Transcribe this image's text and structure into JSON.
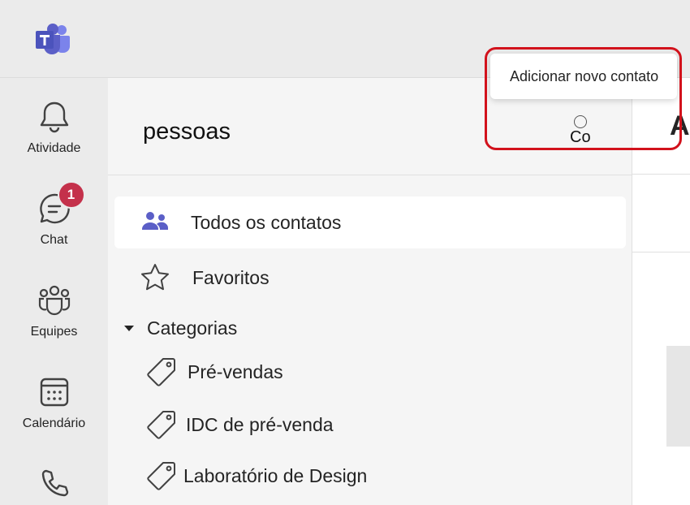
{
  "app": {
    "logo_icon": "teams-logo-icon"
  },
  "rail": {
    "items": [
      {
        "label": "Atividade",
        "icon": "bell-icon"
      },
      {
        "label": "Chat",
        "icon": "chat-icon",
        "badge": "1"
      },
      {
        "label": "Equipes",
        "icon": "teams-icon"
      },
      {
        "label": "Calendário",
        "icon": "calendar-icon"
      },
      {
        "label": "",
        "icon": "phone-icon"
      }
    ]
  },
  "panel": {
    "title": "pessoas",
    "header_action_text": "Co",
    "nav": [
      {
        "label": "Todos os contatos",
        "icon": "people-icon",
        "selected": true
      },
      {
        "label": "Favoritos",
        "icon": "star-icon",
        "selected": false
      }
    ],
    "categories_label": "Categorias",
    "categories": [
      {
        "label": "Pré-vendas",
        "icon": "tag-icon"
      },
      {
        "label": "IDC de pré-venda",
        "icon": "tag-icon"
      },
      {
        "label": "Laboratório de Design",
        "icon": "tag-icon"
      }
    ]
  },
  "right_pane": {
    "heading": "A"
  },
  "popup": {
    "label": "Adicionar novo contato"
  },
  "colors": {
    "accent": "#5b5fc7",
    "badge": "#c4314b",
    "highlight": "#d2121c"
  }
}
